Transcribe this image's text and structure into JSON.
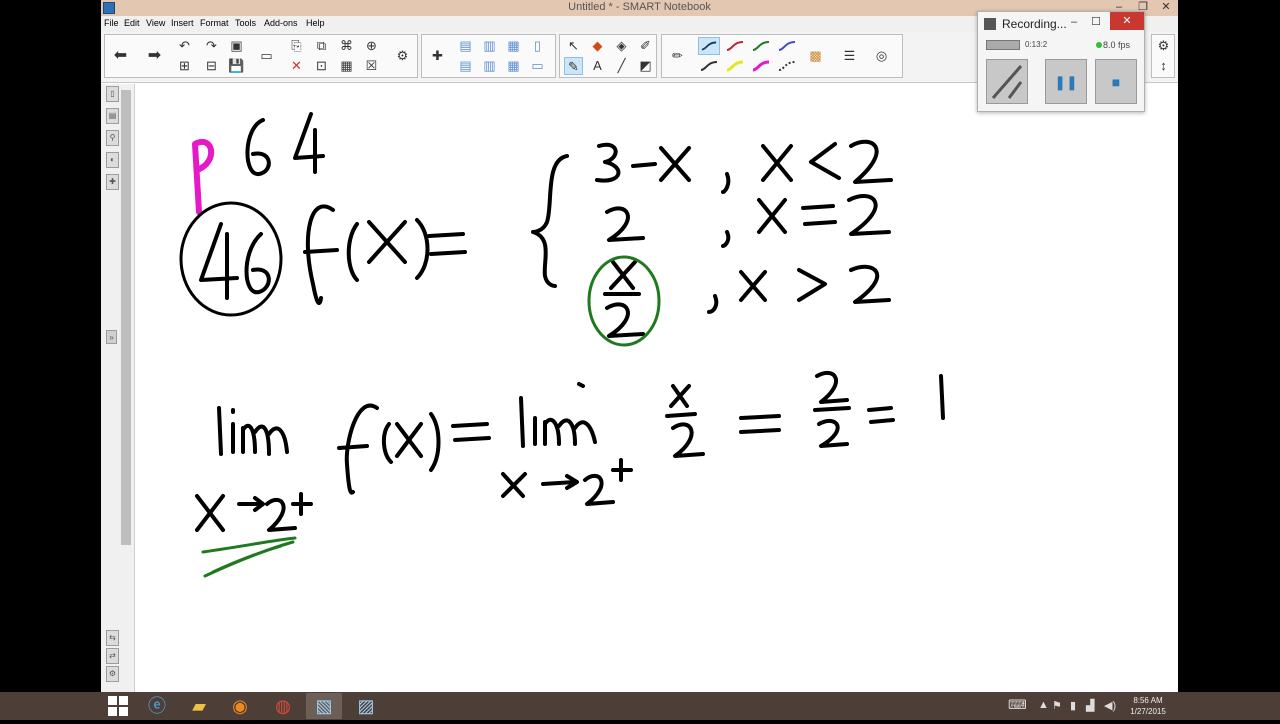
{
  "window": {
    "title": "Untitled * - SMART Notebook",
    "controls": {
      "minimize": "–",
      "maximize": "❐",
      "close": "✕"
    }
  },
  "menu": [
    "File",
    "Edit",
    "View",
    "Insert",
    "Format",
    "Tools",
    "Add-ons",
    "Help"
  ],
  "recorder": {
    "title": "Recording...",
    "time": "0:13:2",
    "fps": "8.0 fps",
    "minimize": "–",
    "maximize": "☐",
    "close": "✕",
    "buttons": [
      "draw",
      "pause",
      "stop"
    ]
  },
  "page_content": {
    "handwritten": [
      "p 64",
      "46",
      "f(x) = { 3 − x , x < 2 ; 2 , x = 2 ; x/2 , x > 2 }",
      "lim x→2+ f(x) = lim x→2+ x/2 = 2/2 = 1"
    ],
    "ink_colors": {
      "black": "#000000",
      "magenta": "#e619c8",
      "green": "#1f7a1f"
    }
  },
  "taskbar": {
    "clock_time": "8:56 AM",
    "clock_date": "1/27/2015",
    "apps": [
      "start",
      "internet-explorer",
      "file-explorer",
      "firefox",
      "chrome",
      "smart-notebook",
      "recorder"
    ]
  },
  "colors": {
    "titlebar": "#e3c7b1",
    "taskbar": "#4e3e38",
    "accent": "#2a7ab8"
  }
}
